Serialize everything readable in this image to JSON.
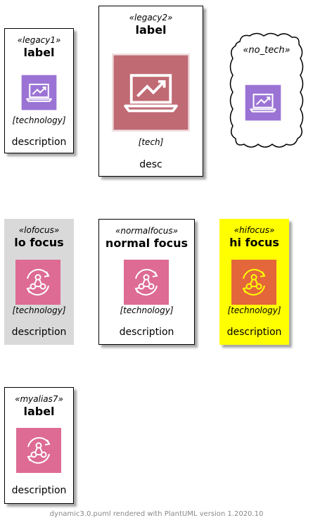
{
  "nodes": {
    "legacy1": {
      "stereotype": "«legacy1»",
      "label": "label",
      "technology": "[technology]",
      "description": "description",
      "icon": "laptop-chart-icon"
    },
    "legacy2": {
      "stereotype": "«legacy2»",
      "label": "label",
      "technology": "[tech]",
      "description": "desc",
      "icon": "laptop-chart-icon"
    },
    "no_tech": {
      "stereotype": "«no_tech»",
      "icon": "laptop-chart-icon"
    },
    "lofocus": {
      "stereotype": "«lofocus»",
      "label": "lo focus",
      "technology": "[technology]",
      "description": "description",
      "icon": "sync-network-icon"
    },
    "normalfocus": {
      "stereotype": "«normalfocus»",
      "label": "normal focus",
      "technology": "[technology]",
      "description": "description",
      "icon": "sync-network-icon"
    },
    "hifocus": {
      "stereotype": "«hifocus»",
      "label": "hi focus",
      "technology": "[technology]",
      "description": "description",
      "icon": "sync-network-icon"
    },
    "myalias7": {
      "stereotype": "«myalias7»",
      "label": "label",
      "description": "description",
      "icon": "sync-network-icon"
    }
  },
  "colors": {
    "purple_icon": "#9b73d4",
    "rose_icon": "#c06a74",
    "pink_icon": "#dd6b93",
    "orange_icon": "#e4663b",
    "lofocus_bg": "#d9d9d9",
    "hifocus_bg": "#ffff00"
  },
  "footer": "dynamic3.0.puml rendered with PlantUML version 1.2020.10"
}
